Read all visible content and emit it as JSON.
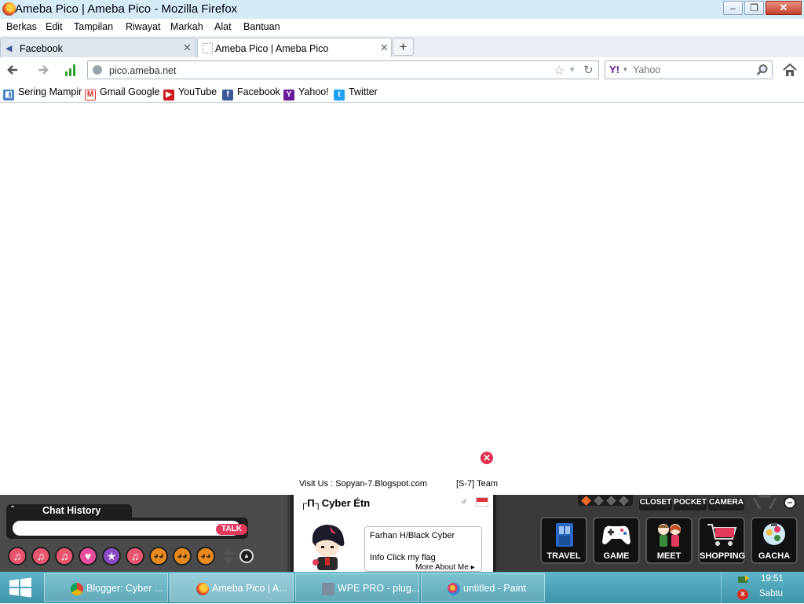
{
  "window": {
    "title": "Ameba Pico | Ameba Pico - Mozilla Firefox",
    "minimize_glyph": "–",
    "restore_glyph": "❐",
    "close_glyph": "✕"
  },
  "menu": {
    "items": [
      {
        "label": "Berkas"
      },
      {
        "label": "Edit"
      },
      {
        "label": "Tampilan"
      },
      {
        "label": "Riwayat"
      },
      {
        "label": "Markah"
      },
      {
        "label": "Alat"
      },
      {
        "label": "Bantuan"
      }
    ]
  },
  "tabs": [
    {
      "label": "Facebook",
      "close": "✕"
    },
    {
      "label": "Ameba Pico | Ameba Pico",
      "close": "✕"
    }
  ],
  "new_tab_glyph": "+",
  "nav": {
    "url": "pico.ameba.net",
    "search_placeholder": "Yahoo"
  },
  "bookmarks": [
    {
      "label": "Sering Mampir",
      "icon": "most-visited-icon",
      "color": "#4a86c8"
    },
    {
      "label": "Gmail Google",
      "icon": "gmail-icon",
      "color": "#d93025"
    },
    {
      "label": "YouTube",
      "icon": "youtube-icon",
      "color": "#cc181e"
    },
    {
      "label": "Facebook",
      "icon": "facebook-icon",
      "color": "#3b5998"
    },
    {
      "label": "Yahoo!",
      "icon": "yahoo-icon",
      "color": "#6a1b9a"
    },
    {
      "label": "Twitter",
      "icon": "twitter-icon",
      "color": "#1da1f2"
    }
  ],
  "game": {
    "visit_text": "Visit Us : Sopyan-7.Blogspot.com",
    "team_text": "[S-7] Team",
    "chat_history_label": "Chat History",
    "talk_label": "TALK",
    "profile": {
      "name": "┌Π┐Cyber Étn",
      "gender": "♂",
      "speech_name": "Farhan H/Black Cyber",
      "speech_info": "Info Click my flag",
      "more_about": "More About Me ▸"
    },
    "quick_buttons": [
      "CLOSET",
      "POCKET",
      "CAMERA"
    ],
    "big_buttons": [
      "TRAVEL",
      "GAME",
      "MEET",
      "SHOPPING",
      "GACHA"
    ]
  },
  "taskbar": {
    "tasks": [
      {
        "label": "Blogger: Cyber ...",
        "icon": "chrome-icon",
        "color": "#e8b51c"
      },
      {
        "label": "Ameba Pico | A...",
        "icon": "firefox-icon",
        "color": "#e8641b"
      },
      {
        "label": "WPE PRO - plug...",
        "icon": "wpe-icon",
        "color": "#7a8ea0"
      },
      {
        "label": "untitled - Paint",
        "icon": "paint-icon",
        "color": "#f0c040"
      }
    ],
    "time": "19:51",
    "day": "Sabtu"
  },
  "colors": {
    "title_bar": "#d6ebf8",
    "taskbar": "#4fa6bb",
    "talk": "#e23a5d",
    "close_ad": "#e2304f"
  }
}
